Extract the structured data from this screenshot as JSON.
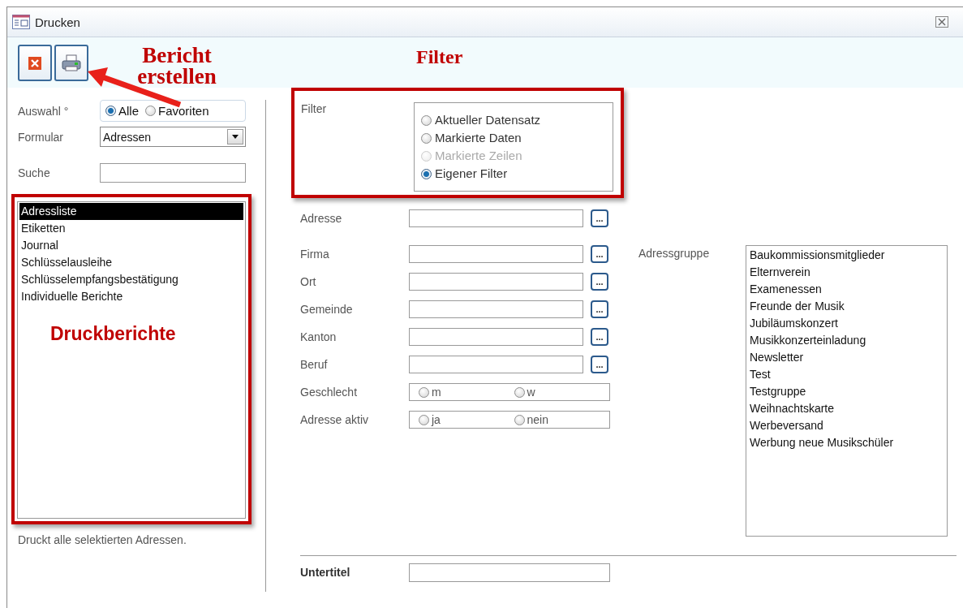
{
  "window": {
    "title": "Drucken"
  },
  "toolbar": {
    "buttons": [
      {
        "kind": "close"
      },
      {
        "kind": "print"
      }
    ]
  },
  "annotations": {
    "button_note": "Bericht erstellen",
    "filter_heading": "Filter",
    "list_note": "Druckberichte"
  },
  "selection": {
    "label": "Auswahl °",
    "options": [
      {
        "label": "Alle",
        "selected": true
      },
      {
        "label": "Favoriten",
        "selected": false
      }
    ]
  },
  "form_select": {
    "label": "Formular",
    "value": "Adressen"
  },
  "search": {
    "label": "Suche"
  },
  "reports": {
    "items": [
      {
        "label": "Adressliste",
        "selected": true
      },
      {
        "label": "Etiketten",
        "selected": false
      },
      {
        "label": "Journal",
        "selected": false
      },
      {
        "label": "Schlüsselausleihe",
        "selected": false
      },
      {
        "label": "Schlüsselempfangsbestätigung",
        "selected": false
      },
      {
        "label": "Individuelle Berichte",
        "selected": false
      }
    ]
  },
  "description": "Druckt alle selektierten Adressen.",
  "filter": {
    "label": "Filter",
    "options": [
      {
        "label": "Aktueller Datensatz",
        "selected": false,
        "disabled": false
      },
      {
        "label": "Markierte Daten",
        "selected": false,
        "disabled": false
      },
      {
        "label": "Markierte Zeilen",
        "selected": false,
        "disabled": true
      },
      {
        "label": "Eigener Filter",
        "selected": true,
        "disabled": false
      }
    ]
  },
  "address_field": {
    "label": "Adresse",
    "button": "..."
  },
  "fields": [
    {
      "kind": "text",
      "label": "Firma",
      "button": "..."
    },
    {
      "kind": "text",
      "label": "Ort",
      "button": "..."
    },
    {
      "kind": "text",
      "label": "Gemeinde",
      "button": "..."
    },
    {
      "kind": "text",
      "label": "Kanton",
      "button": "..."
    },
    {
      "kind": "text",
      "label": "Beruf",
      "button": "..."
    },
    {
      "kind": "radio",
      "label": "Geschlecht",
      "options": [
        {
          "label": "m",
          "selected": false
        },
        {
          "label": "w",
          "selected": false
        }
      ]
    },
    {
      "kind": "radio",
      "label": "Adresse aktiv",
      "options": [
        {
          "label": "ja",
          "selected": false
        },
        {
          "label": "nein",
          "selected": false
        }
      ]
    }
  ],
  "address_groups": {
    "label": "Adressgruppe",
    "items": [
      {
        "label": "Baukommissionsmitglieder"
      },
      {
        "label": "Elternverein"
      },
      {
        "label": "Examenessen"
      },
      {
        "label": "Freunde der Musik"
      },
      {
        "label": "Jubiläumskonzert"
      },
      {
        "label": "Musikkonzerteinladung"
      },
      {
        "label": "Newsletter"
      },
      {
        "label": "Test"
      },
      {
        "label": "Testgruppe"
      },
      {
        "label": "Weihnachtskarte"
      },
      {
        "label": "Werbeversand"
      },
      {
        "label": "Werbung neue Musikschüler"
      }
    ]
  },
  "subtitle": {
    "label": "Untertitel"
  }
}
